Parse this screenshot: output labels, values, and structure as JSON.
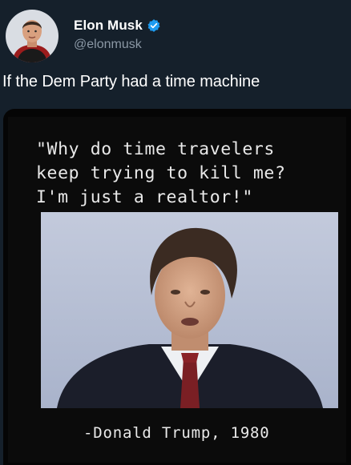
{
  "tweet": {
    "author": {
      "display_name": "Elon Musk",
      "handle": "@elonmusk",
      "verified": true,
      "avatar_icon": "profile-avatar",
      "verified_icon": "verified-badge-icon",
      "verified_color": "#1d9bf0"
    },
    "text": "If the Dem Party had a time machine",
    "media": {
      "quote_lines": [
        "\"Why do time travelers",
        "keep trying to kill me?",
        "I'm just a realtor!\""
      ],
      "attribution": "-Donald Trump, 1980"
    }
  },
  "colors": {
    "background": "#15202b",
    "handle": "#8b98a5",
    "media_background": "#050505"
  }
}
